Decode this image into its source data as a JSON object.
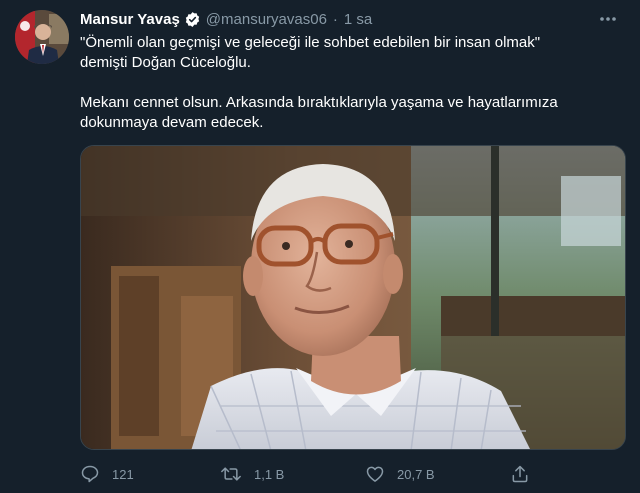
{
  "tweet": {
    "author": {
      "display_name": "Mansur Yavaş",
      "handle": "@mansuryavas06",
      "verified": true
    },
    "separator": "·",
    "time": "1 sa",
    "paragraphs": [
      "\"Önemli olan geçmişi ve geleceği ile sohbet edebilen bir insan olmak\"\ndemişti Doğan Cüceloğlu.",
      "Mekanı cennet olsun. Arkasında bıraktıklarıyla yaşama ve hayatlarımıza\ndokunmaya devam edecek."
    ],
    "media": {
      "description_icon": "photo-of-elderly-man"
    },
    "actions": {
      "reply_count": "121",
      "retweet_count": "1,1 B",
      "like_count": "20,7 B"
    }
  },
  "colors": {
    "background": "#15202b",
    "text": "#ffffff",
    "muted": "#8899a6",
    "border": "#38444d"
  }
}
